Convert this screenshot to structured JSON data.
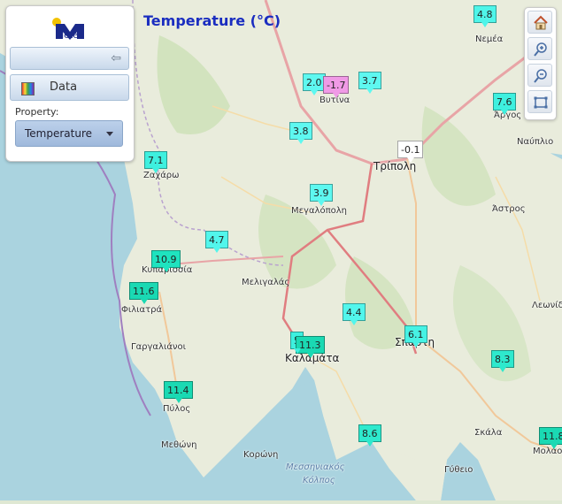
{
  "title": "Temperature (°C)",
  "panel": {
    "logo_text": "Meteo",
    "data_button": "Data",
    "property_label": "Property:",
    "property_value": "Temperature"
  },
  "markers": [
    {
      "value": "4.8"
    },
    {
      "value": "2.0"
    },
    {
      "value": "-1.7"
    },
    {
      "value": "3.7"
    },
    {
      "value": "7.6"
    },
    {
      "value": "3.8"
    },
    {
      "value": "-0.1"
    },
    {
      "value": "7.1"
    },
    {
      "value": "3.9"
    },
    {
      "value": "4.7"
    },
    {
      "value": "10.9"
    },
    {
      "value": "11.6"
    },
    {
      "value": "4.4"
    },
    {
      "value": "11.3"
    },
    {
      "value": "6.1"
    },
    {
      "value": "8.3"
    },
    {
      "value": "11.4"
    },
    {
      "value": "8.6"
    },
    {
      "value": "11.8"
    },
    {
      "value": "5"
    }
  ],
  "places": [
    "Νεμέα",
    "Βυτίνα",
    "Άργος",
    "Ναύπλιο",
    "Τρίπολη",
    "Ζαχάρω",
    "Μεγαλόπολη",
    "Άστρος",
    "Κυπαρισσία",
    "Μελιγαλάς",
    "Φιλιατρά",
    "Λεωνίδιο",
    "Γαργαλιάνοι",
    "Καλαμάτα",
    "Σπάρτη",
    "Πύλος",
    "Σκάλα",
    "Μεθώνη",
    "Κορώνη",
    "Μεσσηνιακός",
    "Κόλπος",
    "Γύθειο",
    "Μολάοι"
  ]
}
